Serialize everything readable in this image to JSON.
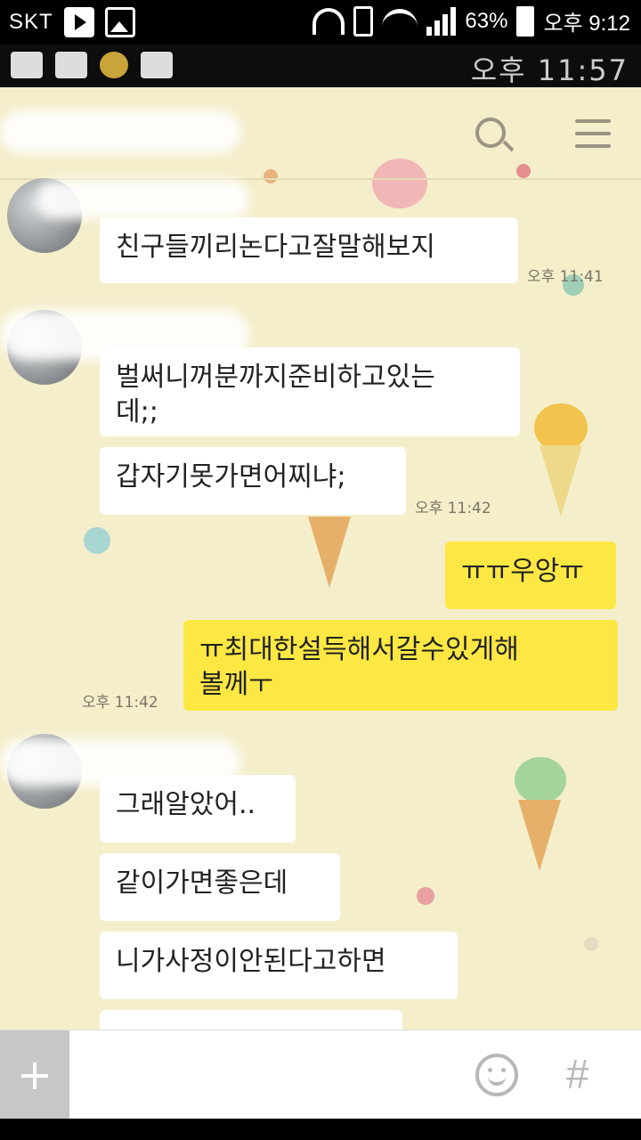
{
  "status_bar": {
    "carrier": "SKT",
    "battery": "63%",
    "time": "오후 9:12"
  },
  "photo_header": {
    "time": "오후 11:57"
  },
  "messages": [
    {
      "text": "친구들끼리논다고잘말해보지",
      "time": "오후 11:41",
      "sender": "friend"
    },
    {
      "text": "벌써니꺼분까지준비하고있는\n데;;",
      "sender": "friend"
    },
    {
      "text": "갑자기못가면어찌냐;",
      "time": "오후 11:42",
      "sender": "friend"
    },
    {
      "text": "ㅠㅠ우앙ㅠ",
      "sender": "me"
    },
    {
      "text": "ㅠ최대한설득해서갈수있게해\n볼께ㅜ",
      "time": "오후 11:42",
      "sender": "me"
    },
    {
      "text": "그래알았어..",
      "sender": "friend"
    },
    {
      "text": "같이가면좋은데",
      "sender": "friend"
    },
    {
      "text": "니가사정이안된다고하면",
      "sender": "friend"
    }
  ],
  "input_bar": {
    "plus": "+",
    "hash": "#"
  },
  "colors": {
    "chat_bg": "#f4eecb",
    "my_bubble": "#fde843",
    "their_bubble": "#ffffff"
  }
}
